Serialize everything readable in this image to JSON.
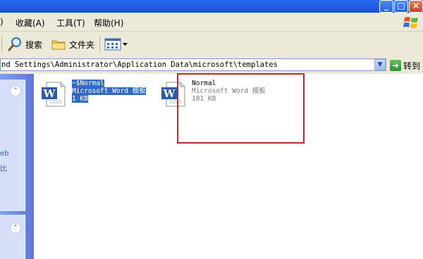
{
  "window": {
    "controls": [
      "_",
      "□",
      "×"
    ]
  },
  "menu": {
    "items": [
      ")",
      "收藏(A)",
      "工具(T)",
      "帮助(H)"
    ]
  },
  "toolbar": {
    "search_label": "搜索",
    "folders_label": "文件夹",
    "views_icon": "views-icon"
  },
  "address": {
    "path": "nd Settings\\Administrator\\Application Data\\microsoft\\templates",
    "go_label": "转到"
  },
  "taskpane": {
    "fragments": [
      "eb",
      "比"
    ]
  },
  "files": [
    {
      "name": "~$Normal",
      "type": "Microsoft Word 模板",
      "size": "1 KB",
      "selected": true
    },
    {
      "name": "Normal",
      "type": "Microsoft Word 模板",
      "size": "101 KB",
      "selected": false
    }
  ],
  "annotation": {
    "color": "#c8262b"
  }
}
